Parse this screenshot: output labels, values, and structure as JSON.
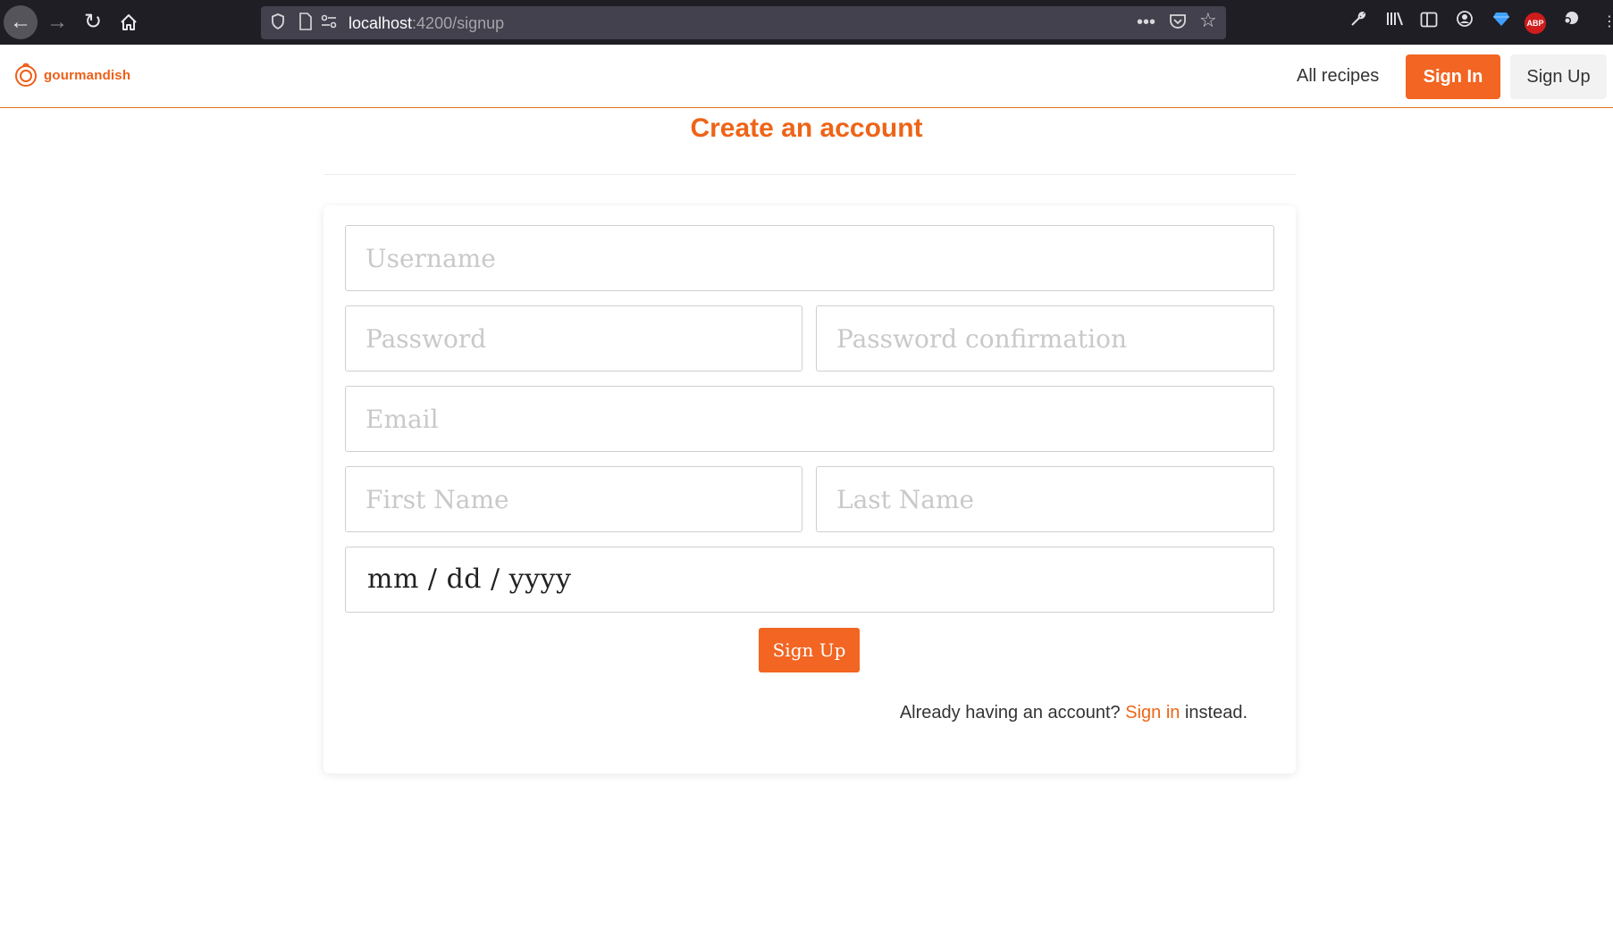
{
  "browser": {
    "url_host": "localhost",
    "url_path": ":4200/signup"
  },
  "navbar": {
    "brand_name": "gourmandish",
    "all_recipes": "All recipes",
    "sign_in": "Sign In",
    "sign_up": "Sign Up",
    "accent_color": "#f26522"
  },
  "page": {
    "title": "Create an account"
  },
  "form": {
    "username_placeholder": "Username",
    "password_placeholder": "Password",
    "password_confirmation_placeholder": "Password confirmation",
    "email_placeholder": "Email",
    "first_name_placeholder": "First Name",
    "last_name_placeholder": "Last Name",
    "date_placeholder": "mm / dd / yyyy",
    "submit_label": "Sign Up"
  },
  "footer_note": {
    "prefix": "Already having an account? ",
    "link": "Sign in",
    "suffix": " instead."
  }
}
